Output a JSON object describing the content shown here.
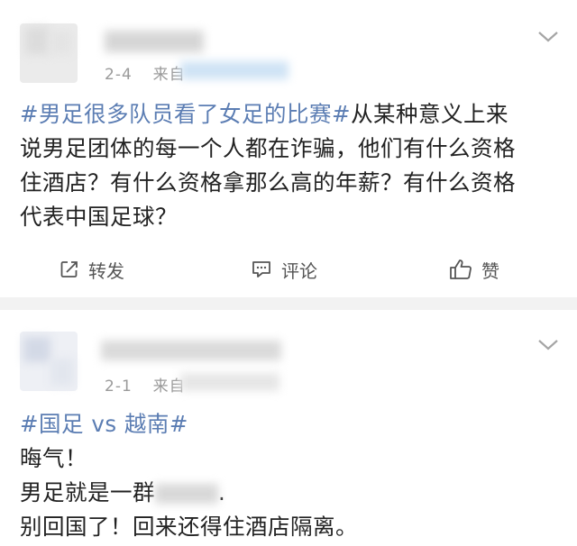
{
  "posts": [
    {
      "date": "2-4",
      "source_prefix": "来自",
      "hashtag": "#男足很多队员看了女足的比赛#",
      "lines": [
        "从某种意义上来",
        "说男足团体的每一个人都在诈骗，他们有什么资格",
        "住酒店？有什么资格拿那么高的年薪？有什么资格",
        "代表中国足球？"
      ],
      "actions": {
        "repost": "转发",
        "comment": "评论",
        "like": "赞"
      }
    },
    {
      "date": "2-1",
      "source_prefix": "来自",
      "hashtag_part1": "#国足",
      "hashtag_vs": " vs ",
      "hashtag_part2": "越南#",
      "line1": "晦气！",
      "line2": "男足就是一群",
      "line2_end": ".",
      "line3": "别回国了！回来还得住酒店隔离。"
    }
  ],
  "colors": {
    "hashtag": "#5b7db3",
    "meta": "#9a9a9a",
    "separator": "#f2f2f2"
  },
  "icons": [
    "chevron-down-icon",
    "repost-icon",
    "comment-icon",
    "like-icon"
  ]
}
